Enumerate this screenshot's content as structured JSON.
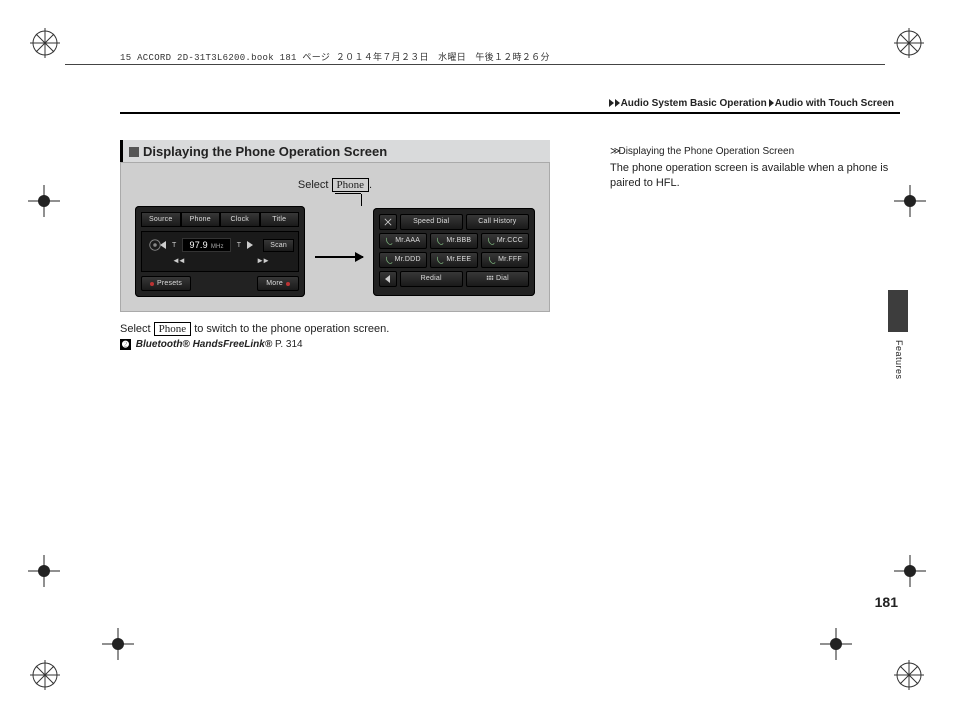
{
  "meta_line": "15 ACCORD 2D-31T3L6200.book  181 ページ  ２０１４年７月２３日　水曜日　午後１２時２６分",
  "breadcrumb": {
    "a": "Audio System Basic Operation",
    "b": "Audio with Touch Screen"
  },
  "section_title": "Displaying the Phone Operation Screen",
  "callout": {
    "select": "Select",
    "button": "Phone"
  },
  "radio": {
    "tabs": [
      "Source",
      "Phone",
      "Clock",
      "Title"
    ],
    "freq_value": "97.9",
    "freq_unit": "MHz",
    "scan": "Scan",
    "presets": "Presets",
    "more": "More"
  },
  "phone_screen": {
    "top": {
      "speed_dial": "Speed Dial",
      "call_history": "Call History"
    },
    "contacts": [
      "Mr.AAA",
      "Mr.BBB",
      "Mr.CCC",
      "Mr.DDD",
      "Mr.EEE",
      "Mr.FFF"
    ],
    "redial": "Redial",
    "dial": "Dial"
  },
  "instruction": {
    "pre": "Select ",
    "btn": "Phone",
    "post": " to switch to the phone operation screen."
  },
  "xref": {
    "title": "Bluetooth® HandsFreeLink®",
    "page": "P. 314"
  },
  "sidebar": {
    "title": "Displaying the Phone Operation Screen",
    "body": "The phone operation screen is available when a phone is paired to HFL."
  },
  "side_label": "Features",
  "page_number": "181"
}
